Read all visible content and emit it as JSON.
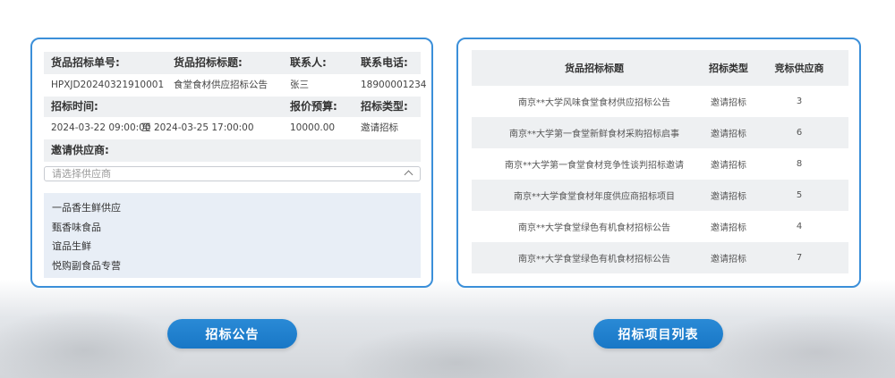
{
  "details": {
    "labels": {
      "order_no": "货品招标单号:",
      "title": "货品招标标题:",
      "contact": "联系人:",
      "phone": "联系电话:",
      "time": "招标时间:",
      "budget": "报价预算:",
      "type": "招标类型:",
      "suppliers": "邀请供应商:"
    },
    "values": {
      "order_no": "HPXJD20240321910001",
      "title": "食堂食材供应招标公告",
      "contact": "张三",
      "phone": "18900001234",
      "start_time": "2024-03-22 09:00:00",
      "time_sep": "至",
      "end_time": "2024-03-25 17:00:00",
      "budget": "10000.00",
      "type": "邀请招标"
    },
    "supplier_select": {
      "placeholder": "请选择供应商",
      "options": [
        "一品香生鲜供应",
        "甄香味食品",
        "谊品生鲜",
        "悦购副食品专营"
      ]
    }
  },
  "table": {
    "headers": [
      "货品招标标题",
      "招标类型",
      "竞标供应商"
    ],
    "rows": [
      [
        "南京**大学风味食堂食材供应招标公告",
        "邀请招标",
        "3"
      ],
      [
        "南京**大学第一食堂新鲜食材采购招标启事",
        "邀请招标",
        "6"
      ],
      [
        "南京**大学第一食堂食材竞争性谈判招标邀请",
        "邀请招标",
        "8"
      ],
      [
        "南京**大学食堂食材年度供应商招标项目",
        "邀请招标",
        "5"
      ],
      [
        "南京**大学食堂绿色有机食材招标公告",
        "邀请招标",
        "4"
      ],
      [
        "南京**大学食堂绿色有机食材招标公告",
        "邀请招标",
        "7"
      ]
    ]
  },
  "buttons": {
    "announcement": "招标公告",
    "project_list": "招标项目列表"
  },
  "colors": {
    "accent": "#1877c6",
    "panel_border": "#3b8fd9",
    "row_gray": "#eef0f2",
    "dropdown_bg": "#e8eef6"
  }
}
